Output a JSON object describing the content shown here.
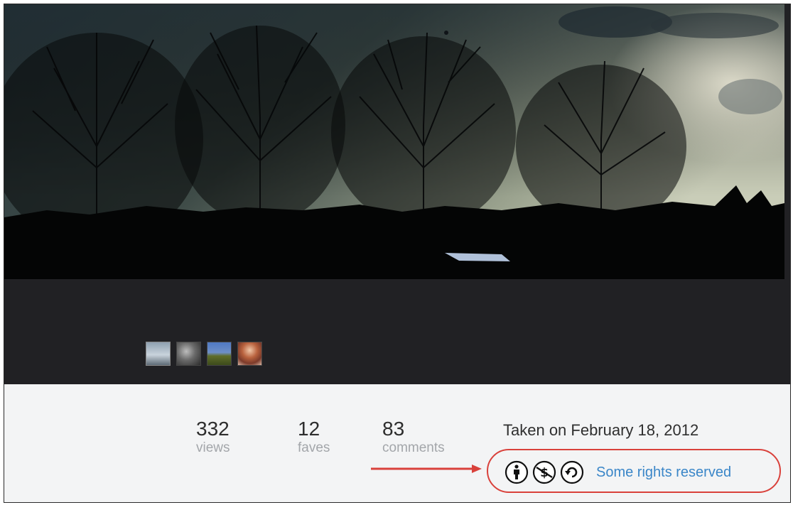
{
  "photo": {
    "thumbnails": [
      "thumb-1",
      "thumb-2",
      "thumb-3",
      "thumb-4"
    ]
  },
  "stats": {
    "views": {
      "value": "332",
      "label": "views"
    },
    "faves": {
      "value": "12",
      "label": "faves"
    },
    "comments": {
      "value": "83",
      "label": "comments"
    }
  },
  "taken": "Taken on February 18, 2012",
  "license": {
    "icons": [
      "cc-attribution-icon",
      "cc-noncommercial-icon",
      "cc-sharealike-icon"
    ],
    "link_text": "Some rights reserved"
  },
  "annotation": {
    "highlight_color": "#d9413b"
  }
}
